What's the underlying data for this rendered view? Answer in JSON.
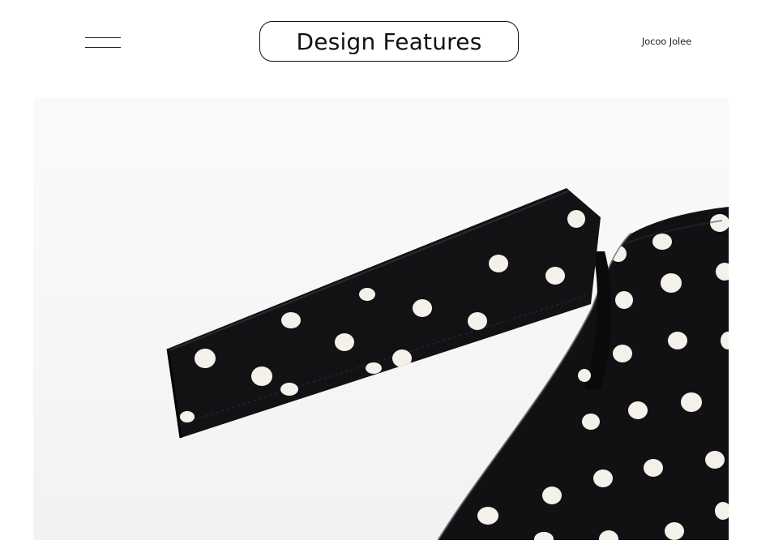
{
  "header": {
    "title": "Design Features",
    "brand": "Jocoo Jolee",
    "menu_icon": "hamburger-menu-icon"
  },
  "photo": {
    "subject": "black polka-dot fabric with shoulder strap",
    "colors": {
      "background": "#f6f6f7",
      "fabric": "#101013",
      "dots": "#f4f1ea"
    }
  }
}
